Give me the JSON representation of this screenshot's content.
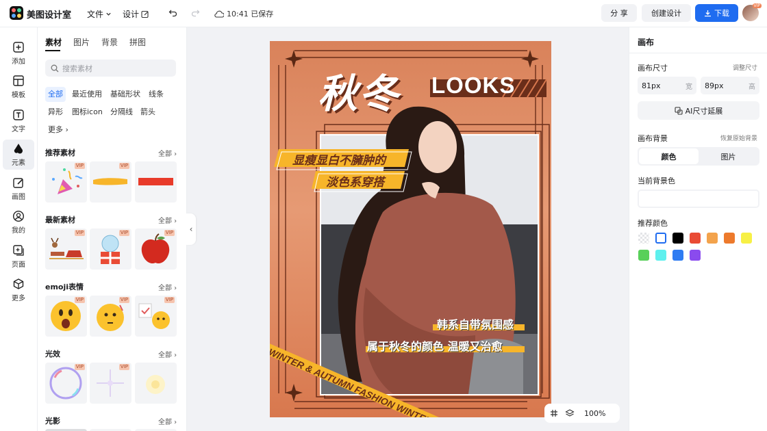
{
  "app": {
    "title": "美图设计室"
  },
  "topbar": {
    "file_menu": "文件",
    "design_menu": "设计",
    "save_status": "10:41 已保存",
    "share_label": "分 享",
    "create_label": "创建设计",
    "download_label": "下载",
    "avatar_badge": "VIP"
  },
  "rail": {
    "items": [
      {
        "label": "添加",
        "icon": "plus-square-icon"
      },
      {
        "label": "模板",
        "icon": "template-icon"
      },
      {
        "label": "文字",
        "icon": "text-icon"
      },
      {
        "label": "元素",
        "icon": "shapes-icon"
      },
      {
        "label": "画图",
        "icon": "pen-icon"
      },
      {
        "label": "我的",
        "icon": "user-icon"
      },
      {
        "label": "页面",
        "icon": "page-add-icon"
      },
      {
        "label": "更多",
        "icon": "cube-icon"
      }
    ],
    "active_index": 3
  },
  "panel": {
    "tabs": [
      "素材",
      "图片",
      "背景",
      "拼图"
    ],
    "search_placeholder": "搜索素材",
    "chips": [
      "全部",
      "最近使用",
      "基础形状",
      "线条",
      "异形",
      "图标icon",
      "分隔线",
      "箭头",
      "更多"
    ],
    "sections": [
      {
        "title": "推荐素材",
        "all": "全部"
      },
      {
        "title": "最新素材",
        "all": "全部"
      },
      {
        "title": "emoji表情",
        "all": "全部"
      },
      {
        "title": "光效",
        "all": "全部"
      },
      {
        "title": "光影",
        "all": "全部"
      }
    ],
    "vip_badge": "VIP"
  },
  "poster": {
    "title_cn": "秋冬",
    "title_en": "LOOKS",
    "tag1": "显瘦显白不臃肿的",
    "tag2": "淡色系穿搭",
    "caption1": "韩系自带氛围感",
    "caption2": "属于秋冬的颜色 温暖又治愈",
    "ribbon": "WINTER & AUTUMN FASHION WINTER"
  },
  "right_panel": {
    "title": "画布",
    "size_label": "画布尺寸",
    "size_link": "调整尺寸",
    "width_value": "81px",
    "width_unit": "宽",
    "height_value": "89px",
    "height_unit": "高",
    "ai_extend": "AI尺寸延展",
    "bg_label": "画布背景",
    "bg_reset": "恢复原始背景",
    "seg_color": "颜色",
    "seg_image": "图片",
    "current_bg": "当前背景色",
    "recommend": "推荐颜色",
    "swatches": [
      "transparent",
      "#ffffff",
      "#000000",
      "#e94b35",
      "#f3a34c",
      "#ed7a2c",
      "#f7f045",
      "#59d05a",
      "#5ef0ee",
      "#2f7cf2",
      "#8a4bee"
    ]
  },
  "zoom": {
    "value": "100%"
  },
  "colors": {
    "accent": "#1f6cf0",
    "poster_orange": "#f7b52a",
    "poster_brown": "#6a2e1a"
  }
}
